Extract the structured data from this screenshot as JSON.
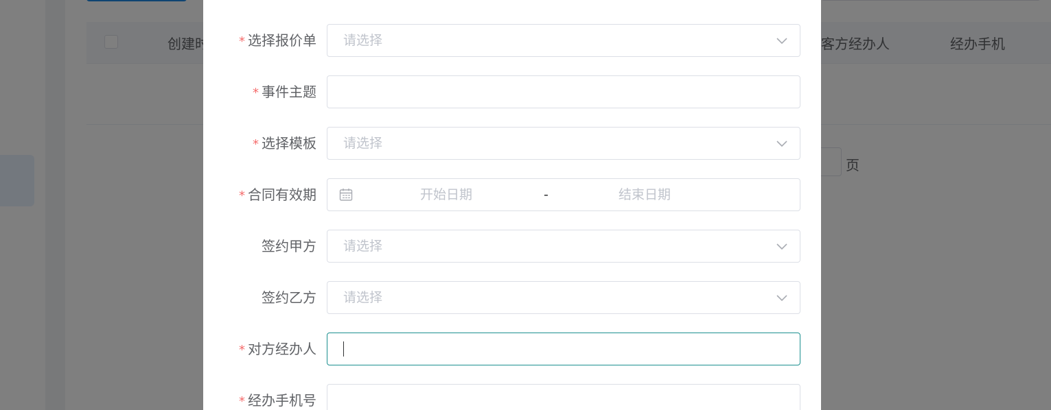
{
  "background": {
    "table_headers": {
      "created": "创建时",
      "agent": "客方经办人",
      "phone": "经办手机"
    },
    "pagination": {
      "page_suffix": "页"
    }
  },
  "dialog": {
    "fields": [
      {
        "label": "选择报价单",
        "required": true,
        "type": "select",
        "placeholder": "请选择"
      },
      {
        "label": "事件主题",
        "required": true,
        "type": "input",
        "placeholder": ""
      },
      {
        "label": "选择模板",
        "required": true,
        "type": "select",
        "placeholder": "请选择"
      },
      {
        "label": "合同有效期",
        "required": true,
        "type": "daterange",
        "start_placeholder": "开始日期",
        "separator": "-",
        "end_placeholder": "结束日期"
      },
      {
        "label": "签约甲方",
        "required": false,
        "type": "select",
        "placeholder": "请选择"
      },
      {
        "label": "签约乙方",
        "required": false,
        "type": "select",
        "placeholder": "请选择"
      },
      {
        "label": "对方经办人",
        "required": true,
        "type": "input",
        "placeholder": "",
        "focused": true
      },
      {
        "label": "经办手机号",
        "required": true,
        "type": "input",
        "placeholder": ""
      }
    ],
    "required_mark": "*",
    "icons": {
      "select": "chevron-down-icon",
      "date": "calendar-icon"
    },
    "colors": {
      "required": "#f56c6c",
      "focus_border": "#1a8f8f",
      "placeholder": "#c0c4cc",
      "label": "#606266"
    }
  }
}
